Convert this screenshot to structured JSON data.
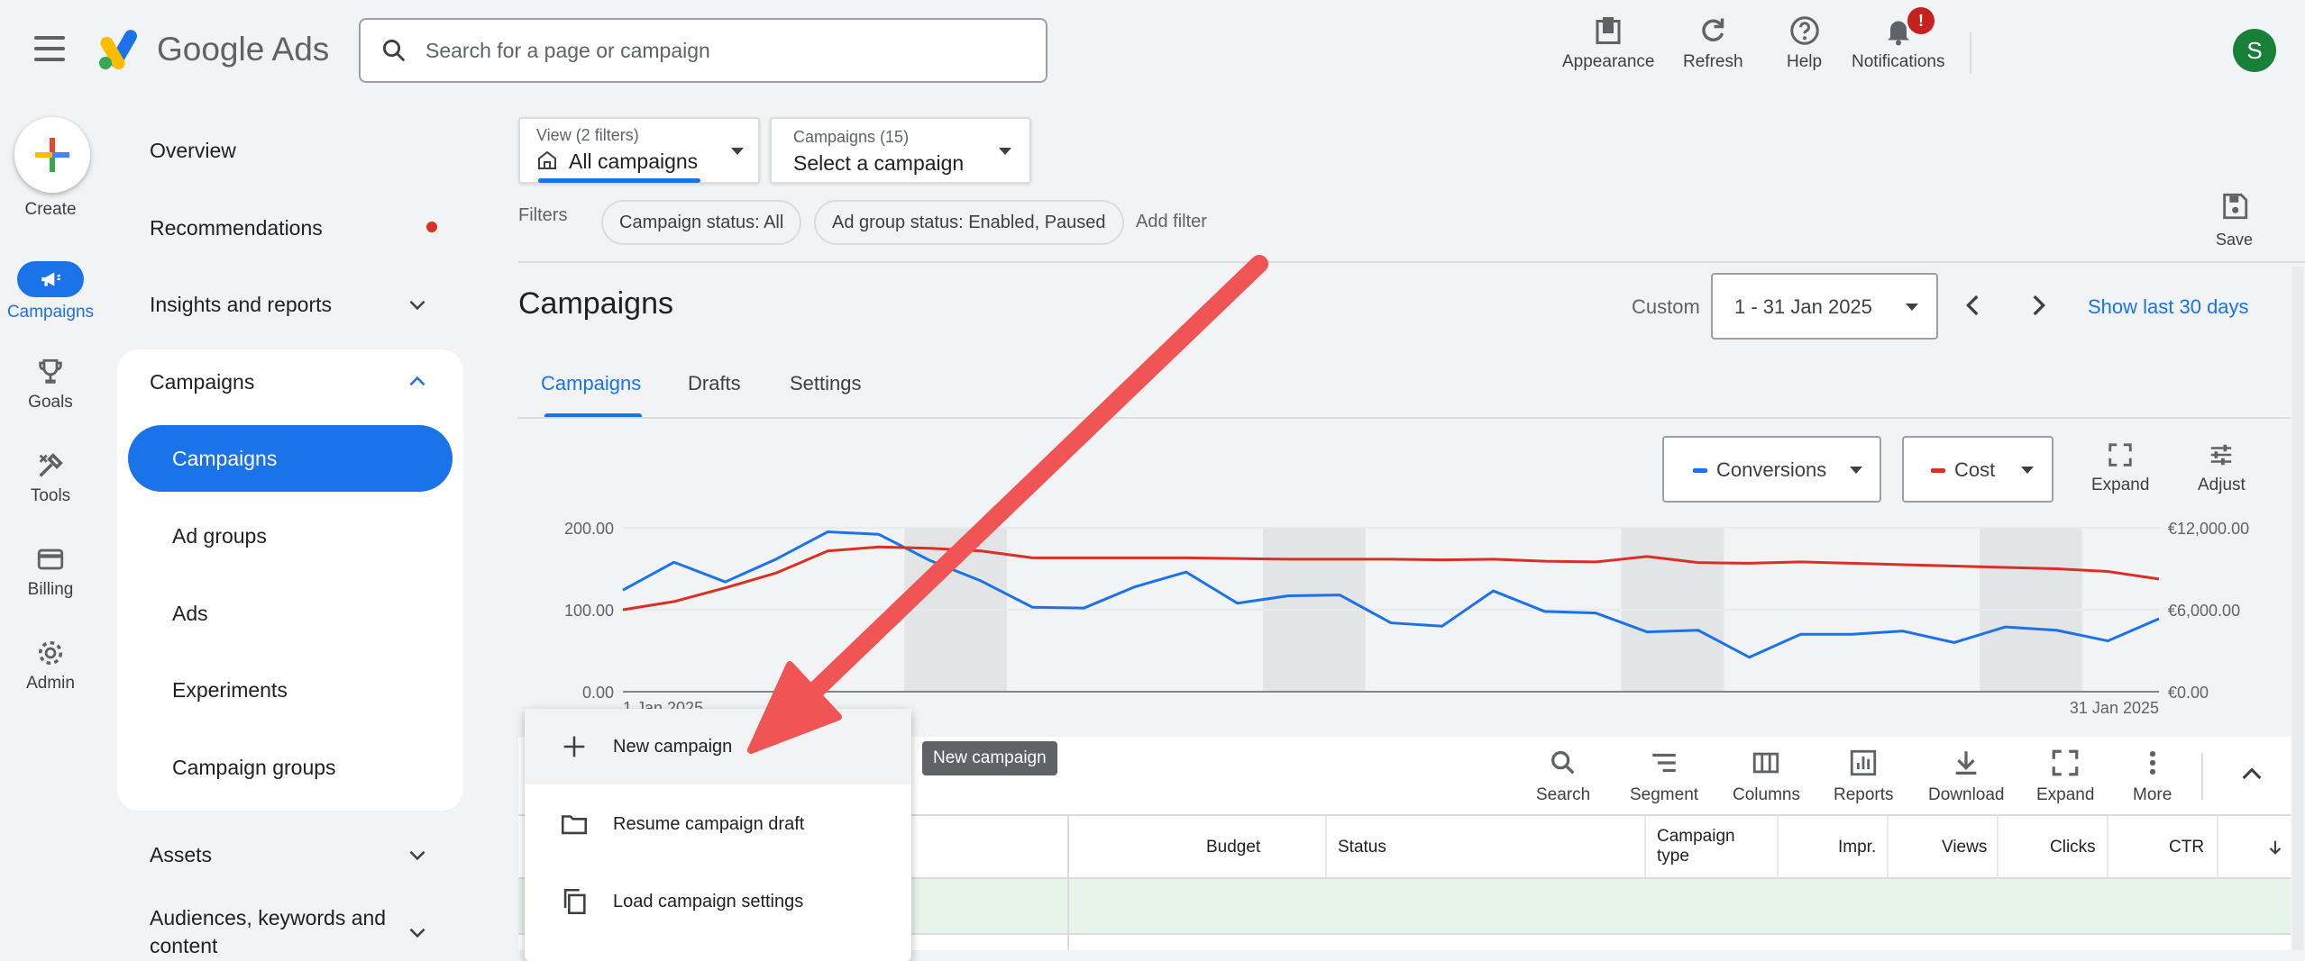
{
  "header": {
    "app_name": "Google Ads",
    "search_placeholder": "Search for a page or campaign",
    "actions": [
      "Appearance",
      "Refresh",
      "Help",
      "Notifications"
    ],
    "notification_badge": "!",
    "avatar_letter": "S"
  },
  "rail": {
    "create": "Create",
    "campaigns": "Campaigns",
    "goals": "Goals",
    "tools": "Tools",
    "billing": "Billing",
    "admin": "Admin"
  },
  "nav": {
    "overview": "Overview",
    "recommendations": "Recommendations",
    "insights": "Insights and reports",
    "campaigns_group": "Campaigns",
    "sub": [
      "Campaigns",
      "Ad groups",
      "Ads",
      "Experiments",
      "Campaign groups"
    ],
    "assets": "Assets",
    "audiences_line1": "Audiences, keywords and",
    "audiences_line2": "content"
  },
  "filters": {
    "view_label": "View (2 filters)",
    "view_value": "All campaigns",
    "campaigns_label": "Campaigns (15)",
    "campaigns_value": "Select a campaign",
    "filters_label": "Filters",
    "chip1": "Campaign status: All",
    "chip2": "Ad group status: Enabled, Paused",
    "add_filter": "Add filter",
    "save": "Save"
  },
  "page": {
    "title": "Campaigns",
    "date_mode": "Custom",
    "date_range": "1 - 31 Jan 2025",
    "show_last": "Show last 30 days",
    "tabs": [
      "Campaigns",
      "Drafts",
      "Settings"
    ]
  },
  "chart_controls": {
    "metric1": "Conversions",
    "metric2": "Cost",
    "expand": "Expand",
    "adjust": "Adjust"
  },
  "chart_data": {
    "type": "line",
    "x_start_label": "1 Jan 2025",
    "x_end_label": "31 Jan 2025",
    "y_left_ticks": [
      "200.00",
      "100.00",
      "0.00"
    ],
    "y_right_ticks": [
      "€12,000.00",
      "€6,000.00",
      "€0.00"
    ],
    "y_left_range": [
      0,
      200
    ],
    "y_right_range": [
      0,
      12000
    ],
    "weekend_bands_days": [
      [
        7,
        8
      ],
      [
        14,
        15
      ],
      [
        21,
        22
      ],
      [
        28,
        29
      ]
    ],
    "series": [
      {
        "name": "Conversions",
        "color": "#1a73e8",
        "axis": "left",
        "values": [
          124,
          158,
          134,
          162,
          195,
          192,
          160,
          135,
          103,
          102,
          128,
          146,
          108,
          117,
          118,
          84,
          80,
          123,
          98,
          96,
          73,
          75,
          42,
          70,
          70,
          74,
          60,
          79,
          75,
          62,
          89
        ]
      },
      {
        "name": "Cost",
        "color": "#d93025",
        "axis": "right",
        "values": [
          6000,
          6600,
          7600,
          8700,
          10300,
          10600,
          10500,
          10300,
          9800,
          9800,
          9800,
          9800,
          9750,
          9700,
          9700,
          9700,
          9650,
          9700,
          9550,
          9500,
          9900,
          9450,
          9400,
          9500,
          9400,
          9300,
          9200,
          9100,
          9000,
          8800,
          8250
        ]
      }
    ]
  },
  "toolbar": [
    "Search",
    "Segment",
    "Columns",
    "Reports",
    "Download",
    "Expand",
    "More"
  ],
  "table": {
    "headers": [
      "Budget",
      "Status",
      "Campaign type",
      "Impr.",
      "Views",
      "Clicks",
      "CTR"
    ]
  },
  "menu": {
    "items": [
      "New campaign",
      "Resume campaign draft",
      "Load campaign settings"
    ]
  },
  "tooltip": "New campaign",
  "colors": {
    "accent": "#1a73e8",
    "annotation_arrow": "#f05454"
  }
}
